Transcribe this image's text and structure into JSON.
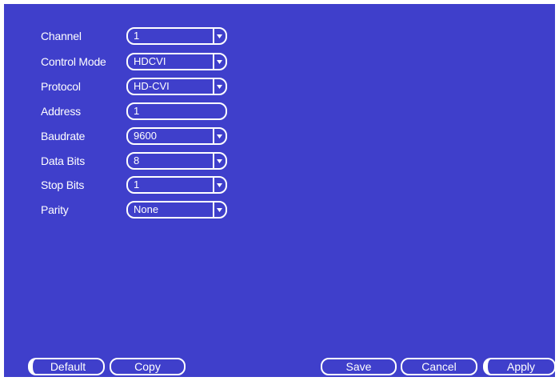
{
  "form": {
    "rows": [
      {
        "label": "Channel",
        "value": "1",
        "dropdown": true
      },
      {
        "label": "Control Mode",
        "value": "HDCVI",
        "dropdown": true
      },
      {
        "label": "Protocol",
        "value": "HD-CVI",
        "dropdown": true
      },
      {
        "label": "Address",
        "value": "1",
        "dropdown": false
      },
      {
        "label": "Baudrate",
        "value": "9600",
        "dropdown": true
      },
      {
        "label": "Data Bits",
        "value": "8",
        "dropdown": true
      },
      {
        "label": "Stop Bits",
        "value": "1",
        "dropdown": true
      },
      {
        "label": "Parity",
        "value": "None",
        "dropdown": true
      }
    ]
  },
  "buttons": {
    "default_label": "Default",
    "copy_label": "Copy",
    "save_label": "Save",
    "cancel_label": "Cancel",
    "apply_label": "Apply"
  },
  "colors": {
    "panel_background": "#3f3fcb",
    "foreground": "#ffffff"
  },
  "icons": {
    "dropdown": "chevron-down-icon"
  }
}
